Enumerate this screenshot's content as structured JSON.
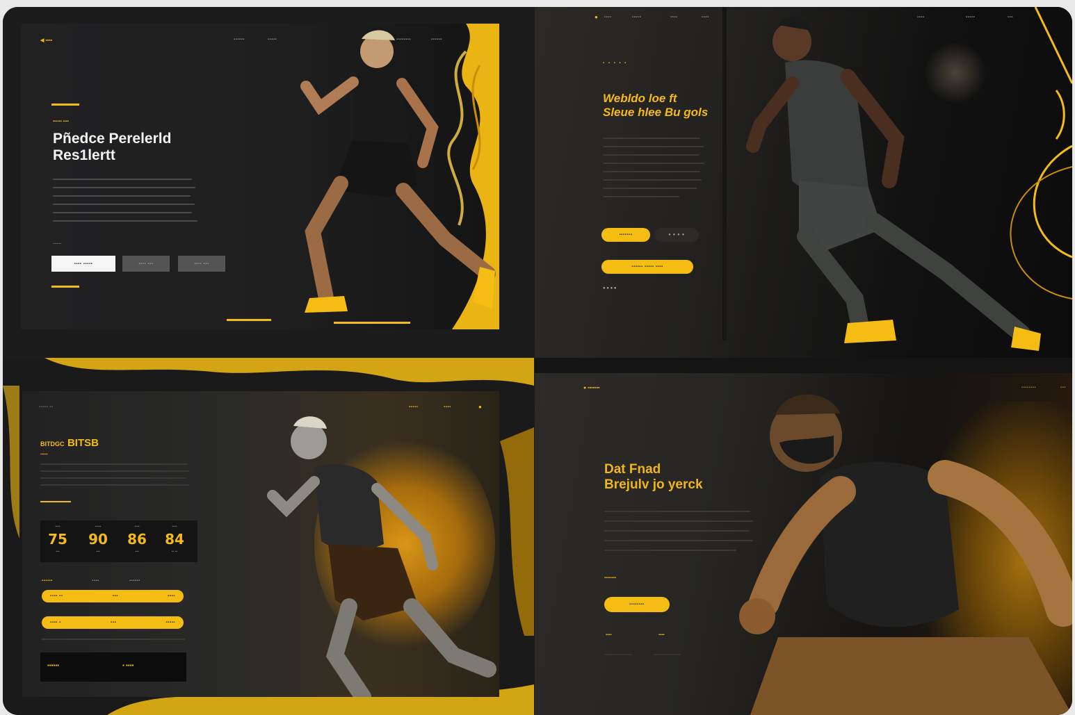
{
  "colors": {
    "accent": "#f5bd14",
    "panel": "#1e1e1f",
    "frame": "#1b1b1c"
  },
  "panel1": {
    "logo": "◀ ▪▪▪▪",
    "nav": [
      "▪▪▪▪▪▪",
      "▪▪▪▪▪",
      "▪▪▪▪▪▪",
      "▪▪▪▪▪▪▪▪",
      "▪▪▪▪▪▪"
    ],
    "eyebrow": "▪▪▪▪▪▪ ▪▪▪▪",
    "title_line1": "Pñedce Perelerld",
    "title_line2": "Res1lertt",
    "cta_label": "▪▪▪▪▪▪▪",
    "buttons": [
      "▪▪▪▪ ▪▪▪▪▪",
      "▪▪▪▪ ▪▪▪",
      "▪▪▪▪ ▪▪▪"
    ]
  },
  "panel2": {
    "nav": [
      "▪▪▪▪",
      "▪▪▪▪▪",
      "▪▪▪▪",
      "▪▪▪▪",
      "▪▪▪▪",
      "▪▪▪▪▪",
      "▪▪▪"
    ],
    "eyebrow": "▪ ▪ ▪ ▪ ▪",
    "title_line1": "Webldo loe ft",
    "title_line2": "Sleue hlee Bu gols",
    "primary_btn": "▪▪▪▪▪▪▪",
    "dots_btn": "● ● ● ●",
    "wide_btn": "▪▪▪▪▪▪ ▪▪▪▪▪ ▪▪▪▪",
    "dots": "● ● ● ●"
  },
  "panel3": {
    "nav": [
      "▪▪▪▪▪",
      "▪▪▪▪",
      "●"
    ],
    "eyebrow": "▪▪▪▪▪ ▪▪",
    "title_a": "BITDGC",
    "title_b": "BITSB",
    "subtitle": "▪▪▪▪▪▪",
    "stats": [
      {
        "label": "▪▪▪▪",
        "value": "75",
        "caption": "▪▪▪"
      },
      {
        "label": "▪▪▪▪▪",
        "value": "90",
        "caption": "▪▪▪"
      },
      {
        "label": "▪▪▪▪",
        "value": "86",
        "caption": "▪▪▪"
      },
      {
        "label": "▪▪▪▪",
        "value": "84",
        "caption": "▪▪ ▪▪"
      }
    ],
    "tabs": [
      "▪▪▪▪▪▪",
      "▪▪▪▪",
      "▪▪▪▪▪▪"
    ],
    "progress": [
      {
        "label": "▪▪▪▪ ▪▪",
        "value": "▪▪▪",
        "tail": "▪▪▪▪"
      },
      {
        "label": "▪▪▪▪ ▪",
        "value": "▪▪▪",
        "tail": "▪▪▪▪▪"
      }
    ],
    "footer_left": "▪▪▪▪▪▪",
    "footer_right": "▪ ▪▪▪▪"
  },
  "panel4": {
    "logo": "● ▪▪▪▪▪▪▪",
    "nav": [
      "▪▪▪▪▪▪▪▪",
      "▪▪▪"
    ],
    "title_line1": "Dat Fnad",
    "title_line2": "Brejulv jo yerck",
    "label": "▪▪▪▪▪▪▪▪",
    "cta": "▪▪▪▪▪▪▪▪",
    "mini": [
      "▪▪▪▪",
      "▪▪▪▪"
    ]
  }
}
